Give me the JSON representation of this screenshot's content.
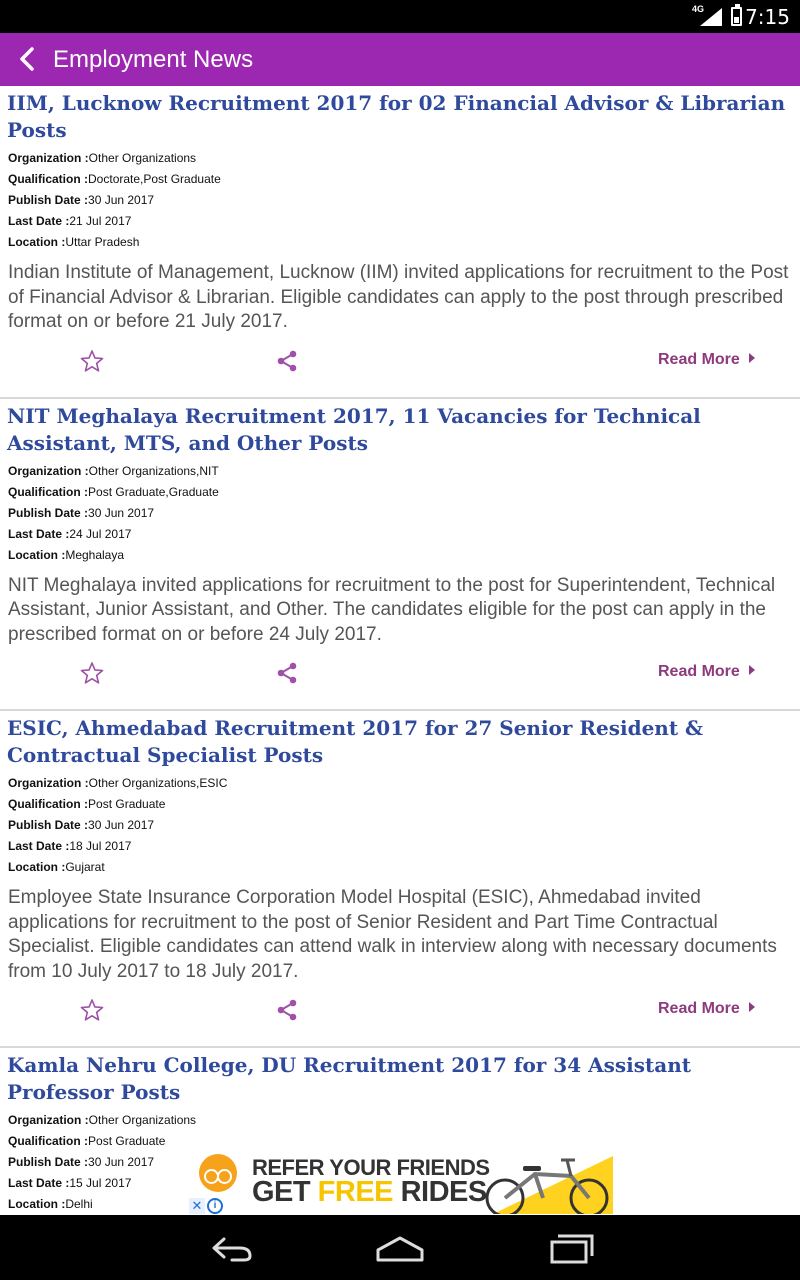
{
  "status_bar": {
    "network": "4G",
    "time": "7:15"
  },
  "app_bar": {
    "title": "Employment News"
  },
  "labels": {
    "organization": "Organization :",
    "qualification": "Qualification :",
    "publish_date": "Publish Date :",
    "last_date": "Last Date :",
    "location": "Location :",
    "read_more": "Read More"
  },
  "colors": {
    "app_bar": "#9c27b0",
    "headline": "#2f4a9c",
    "action_icon": "#a050a8",
    "read_more": "#8e3a7e"
  },
  "articles": [
    {
      "title": "IIM, Lucknow Recruitment 2017 for 02 Financial Advisor & Librarian Posts",
      "organization": "Other Organizations",
      "qualification": "Doctorate,Post Graduate",
      "publish_date": "30 Jun 2017",
      "last_date": "21 Jul 2017",
      "location": "Uttar Pradesh",
      "summary": "Indian Institute of Management, Lucknow (IIM) invited applications for recruitment to the Post of Financial Advisor & Librarian. Eligible candidates can apply to the post through prescribed format on or before 21 July 2017."
    },
    {
      "title": "NIT Meghalaya Recruitment 2017, 11 Vacancies for Technical Assistant, MTS, and Other Posts",
      "organization": "Other Organizations,NIT",
      "qualification": "Post Graduate,Graduate",
      "publish_date": "30 Jun 2017",
      "last_date": "24 Jul 2017",
      "location": "Meghalaya",
      "summary": "NIT Meghalaya invited applications for recruitment to the post for Superintendent, Technical Assistant, Junior Assistant, and Other. The candidates eligible for the post can apply in the prescribed format on or before 24 July 2017."
    },
    {
      "title": "ESIC, Ahmedabad Recruitment 2017 for 27 Senior Resident & Contractual Specialist Posts",
      "organization": "Other Organizations,ESIC",
      "qualification": "Post Graduate",
      "publish_date": "30 Jun 2017",
      "last_date": "18 Jul 2017",
      "location": "Gujarat",
      "summary": "Employee State Insurance Corporation Model Hospital (ESIC), Ahmedabad invited applications for recruitment to the post of Senior Resident and Part Time Contractual Specialist. Eligible candidates can attend walk in interview along with necessary documents from 10 July 2017 to 18 July 2017."
    },
    {
      "title": "Kamla Nehru College, DU Recruitment 2017 for 34 Assistant Professor Posts",
      "organization": "Other Organizations",
      "qualification": "Post Graduate",
      "publish_date": "30 Jun 2017",
      "last_date": "15 Jul 2017",
      "location": "Delhi"
    }
  ],
  "ad": {
    "line1": "REFER YOUR FRIENDS",
    "line2_prefix": "GET ",
    "line2_accent": "FREE",
    "line2_suffix": " RIDES",
    "close_glyph": "✕",
    "info_glyph": "i"
  },
  "nav_bar": {
    "buttons": [
      "back",
      "home",
      "recents"
    ]
  }
}
